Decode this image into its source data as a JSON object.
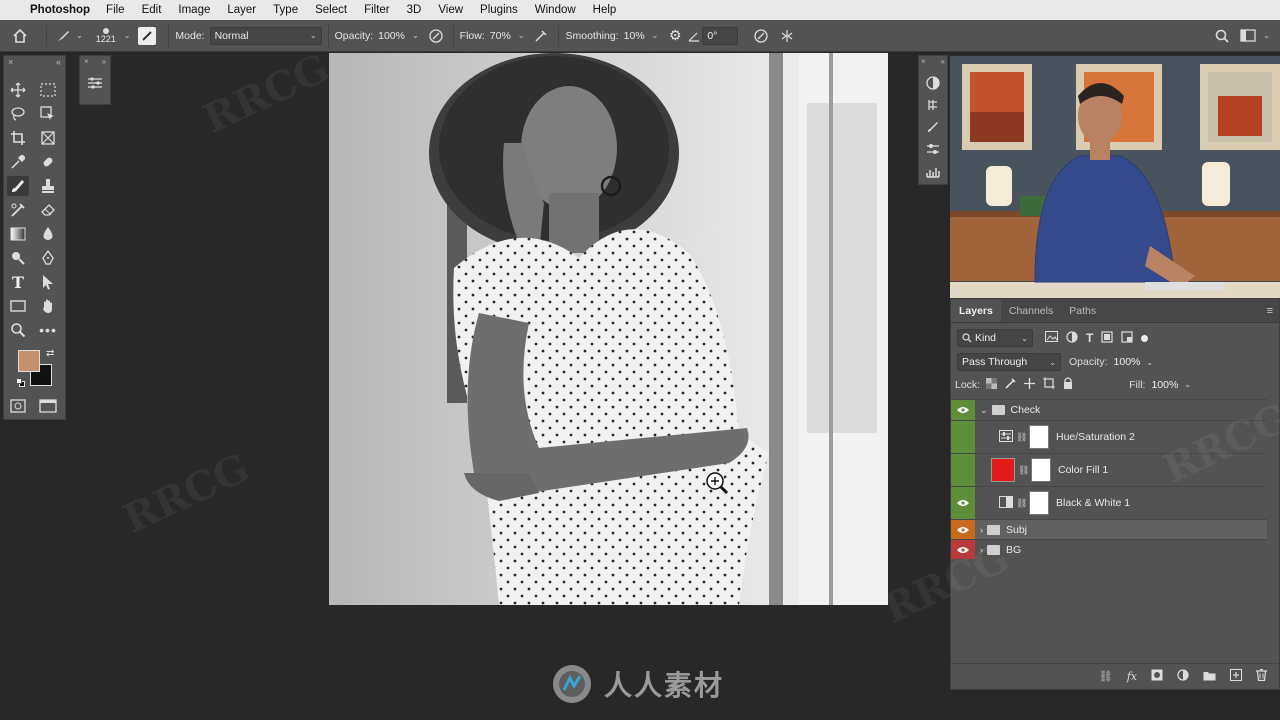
{
  "menubar": {
    "app": "Photoshop",
    "items": [
      "File",
      "Edit",
      "Image",
      "Layer",
      "Type",
      "Select",
      "Filter",
      "3D",
      "View",
      "Plugins",
      "Window",
      "Help"
    ]
  },
  "options": {
    "brush_size": "1221",
    "mode_label": "Mode:",
    "mode_value": "Normal",
    "opacity_label": "Opacity:",
    "opacity_value": "100%",
    "flow_label": "Flow:",
    "flow_value": "70%",
    "smoothing_label": "Smoothing:",
    "smoothing_value": "10%",
    "angle_value": "0°"
  },
  "colors": {
    "foreground": "#c5906e",
    "background": "#111111",
    "eye_green": "#5f8e3a",
    "eye_orange": "#c86a1e",
    "eye_red": "#b83a3a"
  },
  "layers_panel": {
    "tabs": [
      "Layers",
      "Channels",
      "Paths"
    ],
    "filter_label": "Kind",
    "blend_mode": "Pass Through",
    "opacity_label": "Opacity:",
    "opacity_value": "100%",
    "lock_label": "Lock:",
    "fill_label": "Fill:",
    "fill_value": "100%",
    "layers": [
      {
        "name": "Check",
        "type": "group"
      },
      {
        "name": "Hue/Saturation 2",
        "type": "adjustment"
      },
      {
        "name": "Color Fill 1",
        "type": "fill"
      },
      {
        "name": "Black & White 1",
        "type": "adjustment"
      },
      {
        "name": "Subj",
        "type": "group"
      },
      {
        "name": "BG",
        "type": "group"
      }
    ]
  },
  "watermark": {
    "center_text": "人人素材",
    "faint_text": "RRCG"
  }
}
